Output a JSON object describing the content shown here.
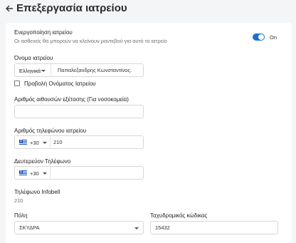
{
  "header": {
    "title": "Επεξεργασία ιατρείου"
  },
  "active": {
    "label": "Ενεργοποίηση ιατρείου",
    "description": "Οι ασθενείς θα μπορούν να κλείνουν ραντεβού για αυτό το ιατρείο",
    "toggle_text": "On",
    "enabled": true
  },
  "clinic_name": {
    "label": "Όνομα ιατρείου",
    "language": "Ελληνικά",
    "value": "Παπαλεξανδρης Κωνσταντίνος.",
    "checkbox_label": "Προβολή Ονόματος Ιατρείου",
    "checked": false
  },
  "rooms": {
    "label": "Αριθμός αιθουσών εξέτασης (Για νοσοκομεία)",
    "value": ""
  },
  "phone": {
    "label": "Αριθμός τηλεφώνου ιατρείου",
    "dial_code": "+30",
    "value": "210"
  },
  "secondary_phone": {
    "label": "Δευτερεύον Τηλέφωνο",
    "dial_code": "+30",
    "value": ""
  },
  "infobell": {
    "label": "Τηλέφωνο Infobell",
    "value": "210"
  },
  "city": {
    "label": "Πόλη",
    "value": "ΣΚΥΔΡΑ"
  },
  "postal_code": {
    "label": "Ταχυδρομικός κώδικας",
    "value": "15432"
  },
  "colors": {
    "accent": "#1e6fd0",
    "background": "#f4f5f7"
  }
}
